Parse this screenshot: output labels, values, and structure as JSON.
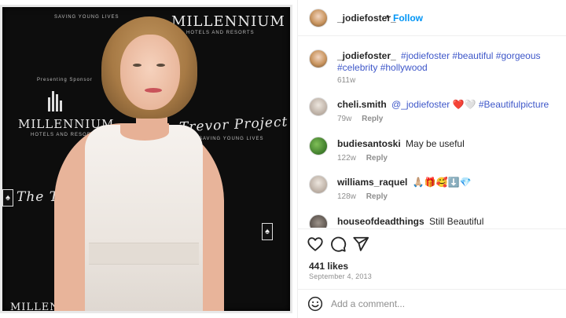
{
  "photo": {
    "backdrop_texts": [
      "MILLENNIUM",
      "MILLENNIUM",
      "Trevor Project",
      "The Tr",
      "M",
      "MILLEN"
    ],
    "small_texts": [
      "SAVING YOUNG LIVES",
      "Presenting Sponsor",
      "HOTELS AND RESORTS",
      "SAVING YOUNG LIVES"
    ]
  },
  "header": {
    "username": "_jodiefoster_",
    "separator": "•",
    "follow_label": "Follow"
  },
  "caption": {
    "username": "_jodiefoster_",
    "text": "#jodiefoster #beautiful #gorgeous #celebrity #hollywood",
    "time": "611w"
  },
  "comments": [
    {
      "username": "cheli.smith",
      "mention": "@_jodiefoster",
      "emojis": "❤️🤍",
      "tag": "#Beautifulpicture",
      "time": "79w",
      "reply": "Reply"
    },
    {
      "username": "budiesantoski",
      "text": "May be useful",
      "time": "122w",
      "reply": "Reply"
    },
    {
      "username": "williams_raquel",
      "text": "🙏🏼🎁🥰⬇️💎",
      "time": "128w",
      "reply": "Reply"
    },
    {
      "username": "houseofdeadthings",
      "text": "Still Beautiful"
    }
  ],
  "icons": {
    "like": "heart-icon",
    "comment": "comment-icon",
    "share": "send-icon",
    "emoji": "smiley-icon"
  },
  "likes": "441 likes",
  "date": "September 4, 2013",
  "add_comment": {
    "placeholder": "Add a comment..."
  },
  "colors": {
    "link": "#3e57c9",
    "follow": "#0095f6",
    "heart": "#ed4956",
    "meta": "#8e8e8e"
  }
}
